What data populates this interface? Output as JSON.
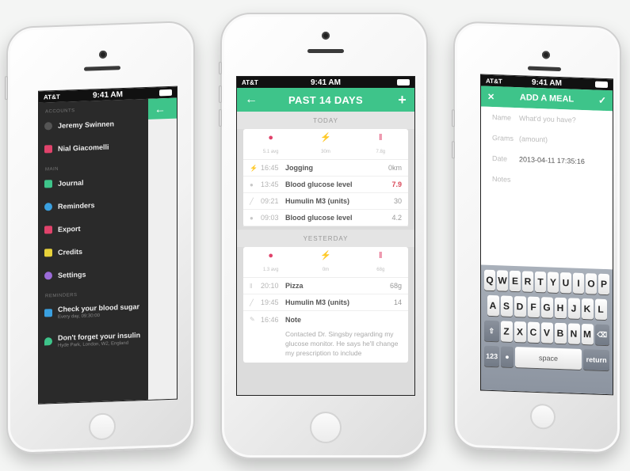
{
  "left_phone": {
    "status": {
      "carrier": "AT&T",
      "time": "9:41 AM"
    },
    "sections": {
      "accounts": "ACCOUNTS",
      "main": "MAIN",
      "reminders": "REMINDERS"
    },
    "accounts": [
      "Jeremy Swinnen",
      "Nial Giacomelli"
    ],
    "menu": [
      {
        "label": "Journal",
        "color": "#3ec48a"
      },
      {
        "label": "Reminders",
        "color": "#3aa0e0"
      },
      {
        "label": "Export",
        "color": "#e0436b"
      },
      {
        "label": "Credits",
        "color": "#e8d23a"
      },
      {
        "label": "Settings",
        "color": "#9b6bd8"
      }
    ],
    "reminders": [
      {
        "title": "Check your blood sugar",
        "sub": "Every day, 09:30:00"
      },
      {
        "title": "Don't forget your insulin",
        "sub": "Hyde Park, London, W2, England"
      }
    ],
    "back_icon": "arrow-left-icon"
  },
  "middle_phone": {
    "status": {
      "carrier": "AT&T",
      "time": "9:41 AM"
    },
    "header": {
      "title": "PAST 14 DAYS",
      "left_icon": "arrow-left-icon",
      "right_icon": "plus-icon"
    },
    "today": {
      "label": "TODAY",
      "stats": [
        {
          "icon": "drop-icon",
          "value": "5.1 avg"
        },
        {
          "icon": "bolt-icon",
          "value": "30m"
        },
        {
          "icon": "fork-icon",
          "value": "7.8g"
        }
      ],
      "rows": [
        {
          "time": "16:45",
          "label": "Jogging",
          "value": "0km",
          "highlight": false
        },
        {
          "time": "13:45",
          "label": "Blood glucose level",
          "value": "7.9",
          "highlight": true
        },
        {
          "time": "09:21",
          "label": "Humulin M3 (units)",
          "value": "30",
          "highlight": false
        },
        {
          "time": "09:03",
          "label": "Blood glucose level",
          "value": "4.2",
          "highlight": false
        }
      ]
    },
    "yesterday": {
      "label": "YESTERDAY",
      "stats": [
        {
          "icon": "drop-icon",
          "value": "1.3 avg"
        },
        {
          "icon": "bolt-icon",
          "value": "0m"
        },
        {
          "icon": "fork-icon",
          "value": "68g"
        }
      ],
      "rows": [
        {
          "time": "20:10",
          "label": "Pizza",
          "value": "68g",
          "highlight": false
        },
        {
          "time": "19:45",
          "label": "Humulin M3 (units)",
          "value": "14",
          "highlight": false
        },
        {
          "time": "16:46",
          "label": "Note",
          "value": "",
          "highlight": false
        }
      ],
      "note": "Contacted Dr. Singsby regarding my glucose monitor. He says he'll change my prescription to include"
    }
  },
  "right_phone": {
    "status": {
      "carrier": "AT&T",
      "time": "9:41 AM"
    },
    "header": {
      "title": "ADD A MEAL",
      "left_icon": "close-icon",
      "right_icon": "checkmark-icon"
    },
    "fields": [
      {
        "label": "Name",
        "value": "",
        "placeholder": "What'd you have?"
      },
      {
        "label": "Grams",
        "value": "",
        "placeholder": "(amount)"
      },
      {
        "label": "Date",
        "value": "2013-04-11 17:35:16",
        "placeholder": ""
      },
      {
        "label": "Notes",
        "value": "",
        "placeholder": ""
      }
    ],
    "keyboard": {
      "row1": [
        "Q",
        "W",
        "E",
        "R",
        "T",
        "Y",
        "U",
        "I",
        "O",
        "P"
      ],
      "row2": [
        "A",
        "S",
        "D",
        "F",
        "G",
        "H",
        "J",
        "K",
        "L"
      ],
      "row3": [
        "Z",
        "X",
        "C",
        "V",
        "B",
        "N",
        "M"
      ],
      "shift": "⇧",
      "delete": "⌫",
      "num": "123",
      "mic": "🎤",
      "space": "space",
      "return": "return"
    }
  }
}
